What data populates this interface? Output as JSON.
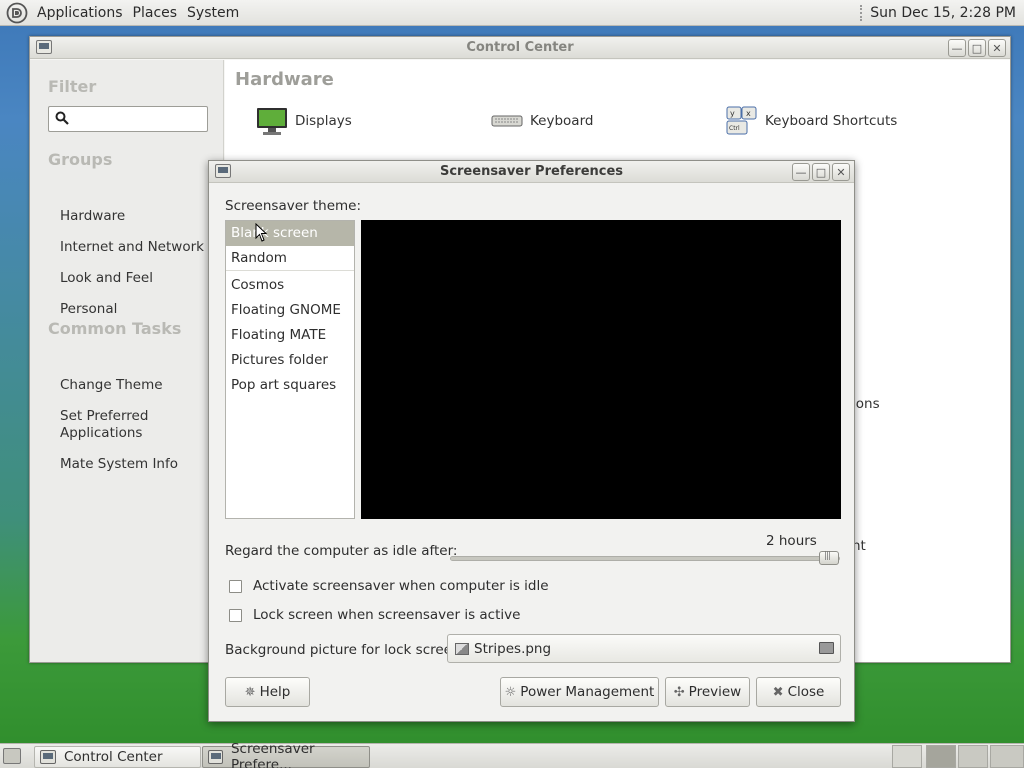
{
  "top_panel": {
    "menus": [
      "Applications",
      "Places",
      "System"
    ],
    "clock": "Sun Dec 15,  2:28 PM"
  },
  "control_center": {
    "title": "Control Center",
    "filter_heading": "Filter",
    "filter_placeholder": "",
    "groups_heading": "Groups",
    "groups": [
      "Hardware",
      "Internet and Network",
      "Look and Feel",
      "Personal"
    ],
    "common_tasks_heading": "Common Tasks",
    "tasks": [
      "Change Theme",
      "Set Preferred Applications",
      "Mate System Info"
    ],
    "main_heading": "Hardware",
    "items": [
      {
        "label": "Displays",
        "icon": "monitor-icon"
      },
      {
        "label": "Keyboard",
        "icon": "keyboard-icon"
      },
      {
        "label": "Keyboard Shortcuts",
        "icon": "keyboard-shortcuts-icon"
      }
    ],
    "partial_labels": [
      "ions",
      "nt"
    ]
  },
  "screensaver": {
    "title": "Screensaver Preferences",
    "theme_label": "Screensaver theme:",
    "themes": [
      "Blank screen",
      "Random",
      "Cosmos",
      "Floating GNOME",
      "Floating MATE",
      "Pictures folder",
      "Pop art squares"
    ],
    "selected_theme": "Blank screen",
    "idle_label": "Regard the computer as idle after:",
    "idle_value": "2 hours",
    "idle_fraction": 1.0,
    "activate_label": "Activate screensaver when computer is idle",
    "activate_checked": false,
    "lock_label": "Lock screen when screensaver is active",
    "lock_checked": false,
    "bg_label": "Background picture for lock screen:",
    "bg_file": "Stripes.png",
    "buttons": {
      "help": "Help",
      "power": "Power Management",
      "preview": "Preview",
      "close": "Close"
    }
  },
  "taskbar": {
    "tasks": [
      "Control Center",
      "Screensaver Prefere..."
    ]
  }
}
